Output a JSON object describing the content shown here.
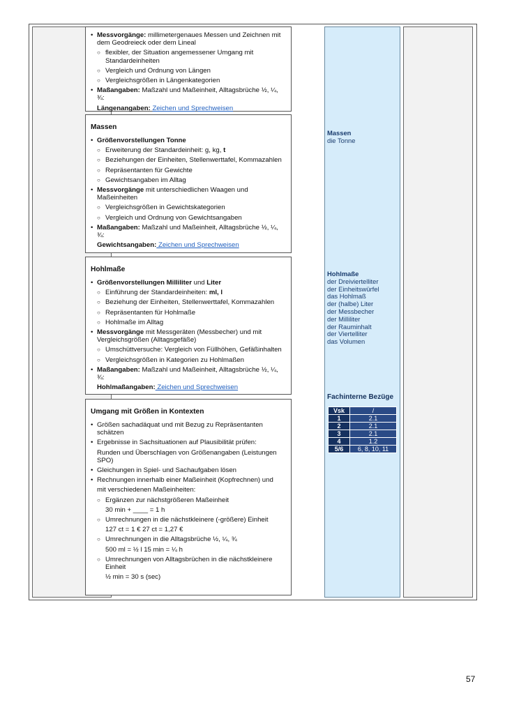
{
  "page_number": "57",
  "box1": {
    "items": [
      {
        "level": 1,
        "bold": "Messvorgänge:",
        "text": " millimetergenaues Messen und Zeichnen mit dem Geodreieck oder dem Lineal"
      },
      {
        "level": 2,
        "text": "flexibler, der Situation angemessener Umgang mit Standardeinheiten"
      },
      {
        "level": 2,
        "text": "Vergleich und Ordnung von Längen"
      },
      {
        "level": 2,
        "text": "Vergleichsgrößen in Längenkategorien"
      },
      {
        "level": 1,
        "bold": "Maßangaben:",
        "text": " Maßzahl und Maßeinheit, Alltagsbrüche ½, ¼, ¾:"
      }
    ],
    "footer_bold": "Längenangaben:",
    "footer_link": "Zeichen und Sprechweisen"
  },
  "box2": {
    "title": "Massen",
    "items": [
      {
        "level": 1,
        "bold": "Größenvorstellungen Tonne",
        "text": ""
      },
      {
        "level": 2,
        "text": "Erweiterung der Standardeinheit: g, kg, ",
        "bold_end": "t"
      },
      {
        "level": 2,
        "text": "Beziehungen der Einheiten, Stellenwerttafel, Kommazahlen"
      },
      {
        "level": 2,
        "text": "Repräsentanten für Gewichte"
      },
      {
        "level": 2,
        "text": "Gewichtsangaben im Alltag"
      },
      {
        "level": 1,
        "bold": "Messvorgänge",
        "text": " mit unterschiedlichen Waagen und Maßeinheiten"
      },
      {
        "level": 2,
        "text": "Vergleichsgrößen in Gewichtskategorien"
      },
      {
        "level": 2,
        "text": "Vergleich und Ordnung von Gewichtsangaben"
      },
      {
        "level": 1,
        "bold": "Maßangaben:",
        "text": " Maßzahl und Maßeinheit, Alltagsbrüche ½, ¼, ¾:"
      }
    ],
    "footer_bold": "Gewichtsangaben:",
    "footer_link": " Zeichen und Sprechweisen"
  },
  "box3": {
    "title": "Hohlmaße",
    "items": [
      {
        "level": 1,
        "bold": "Größenvorstellungen Milliliter",
        "text": " und ",
        "bold_end": "Liter"
      },
      {
        "level": 2,
        "text": "Einführung der Standardeinheiten: ",
        "bold_end": "ml, l"
      },
      {
        "level": 2,
        "text": "Beziehung der Einheiten, Stellenwerttafel, Kommazahlen"
      },
      {
        "level": 2,
        "text": "Repräsentanten für Hohlmaße"
      },
      {
        "level": 2,
        "text": "Hohlmaße im Alltag"
      },
      {
        "level": 1,
        "bold": "Messvorgänge",
        "text": " mit Messgeräten (Messbecher) und mit Vergleichsgrößen (Alltagsgefäße)"
      },
      {
        "level": 2,
        "text": "Umschüttversuche: Vergleich von Füllhöhen, Gefäßinhalten"
      },
      {
        "level": 2,
        "text": "Vergleichsgrößen in Kategorien zu Hohlmaßen"
      },
      {
        "level": 1,
        "bold": "Maßangaben:",
        "text": " Maßzahl und Maßeinheit, Alltagsbrüche ½, ¼, ¾:"
      }
    ],
    "footer_bold": "Hohlmaßangaben:",
    "footer_link": " Zeichen und Sprechweisen"
  },
  "box4": {
    "title": "Umgang mit Größen in Kontexten",
    "items": [
      {
        "level": 1,
        "text": "Größen sachadäquat und mit Bezug zu Repräsentanten schätzen"
      },
      {
        "level": 1,
        "text": "Ergebnisse in Sachsituationen auf Plausibilität prüfen:"
      },
      {
        "level": 0,
        "text": "Runden und Überschlagen von Größenangaben (Leistungen SPO)"
      },
      {
        "level": 1,
        "text": "Gleichungen in Spiel- und Sachaufgaben lösen"
      },
      {
        "level": 1,
        "text": "Rechnungen innerhalb einer Maßeinheit (Kopfrechnen) und"
      },
      {
        "level": 0,
        "text": "mit verschiedenen Maßeinheiten:"
      },
      {
        "level": 2,
        "text": "Ergänzen zur nächstgrößeren Maßeinheit"
      },
      {
        "level": 3,
        "text": "30 min + ____ = 1 h"
      },
      {
        "level": 2,
        "text": "Umrechnungen in die nächstkleinere (-größere) Einheit"
      },
      {
        "level": 3,
        "text": "127 ct     =      1 € 27 ct      =      1,27 €"
      },
      {
        "level": 2,
        "text": "Umrechnungen in die Alltagsbrüche ½, ¼, ¾"
      },
      {
        "level": 3,
        "text": "500 ml = ½ l                                    15 min = ¼ h"
      },
      {
        "level": 2,
        "text": "Umrechnungen von Alltagsbrüchen in die nächstkleinere Einheit"
      },
      {
        "level": 3,
        "text": "½ min = 30 s (sec)"
      }
    ]
  },
  "vocab_massen": {
    "heading": "Massen",
    "terms": [
      "die Tonne"
    ]
  },
  "vocab_hohlmasse": {
    "heading": "Hohlmaße",
    "terms": [
      "der Dreiviertelliter",
      "der Einheitswürfel",
      "das Hohlmaß",
      "der (halbe) Liter",
      "der Messbecher",
      "der Milliliter",
      "der Rauminhalt",
      "der Viertelliter",
      "das Volumen"
    ]
  },
  "fachintern": {
    "heading": "Fachinterne Bezüge",
    "header": [
      "Vsk",
      "/"
    ],
    "rows": [
      [
        "1",
        "2.1"
      ],
      [
        "2",
        "2.1"
      ],
      [
        "3",
        "2.1"
      ],
      [
        "4",
        "1.2"
      ],
      [
        "5/6",
        "6, 8, 10, 11"
      ]
    ]
  }
}
